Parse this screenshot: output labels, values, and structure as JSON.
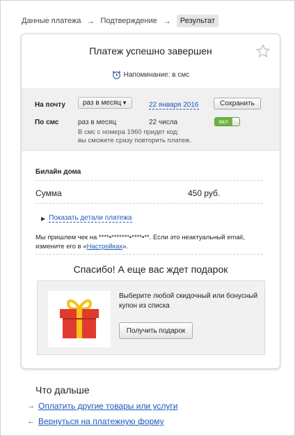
{
  "breadcrumb": {
    "steps": [
      "Данные платежа",
      "Подтверждение",
      "Результат"
    ],
    "separator": "→"
  },
  "result": {
    "title": "Платеж успешно завершен",
    "reminder": "Напоминание: в смс",
    "star_icon": "star-icon",
    "alarm_icon": "alarm-clock-icon"
  },
  "reminders": {
    "email": {
      "label": "На почту",
      "frequency": "раз в месяц",
      "date": "22 января 2016",
      "save_label": "Сохранить"
    },
    "sms": {
      "label": "По смс",
      "frequency": "раз в месяц",
      "day": "22 числа",
      "toggle_label": "вкл",
      "toggle_on": true,
      "hint_line1": "В смс с номера 1960 придет код:",
      "hint_line2": "вы сможете сразу повторить платеж."
    }
  },
  "payment": {
    "service": "Билайн дома",
    "sum_label": "Сумма",
    "sum_value": "450 руб.",
    "details_link": "Показать детали платежа"
  },
  "receipt": {
    "text_before": "Мы пришлем чек на ****•*******•****•**. Если это неактуальный email, измените его в «",
    "link": "Настройках",
    "text_after": "»."
  },
  "gift": {
    "title": "Спасибо! А еще вас ждет подарок",
    "description": "Выберите любой скидочный или бонусный купон из списка",
    "button": "Получить подарок",
    "icon": "gift-icon"
  },
  "next": {
    "title": "Что дальше",
    "links": [
      {
        "arrow": "→",
        "label": "Оплатить другие товары или услуги"
      },
      {
        "arrow": "←",
        "label": "Вернуться на платежную форму"
      }
    ]
  },
  "colors": {
    "link": "#1b58b8",
    "toggle_green": "#6cb33f",
    "gift_red": "#e03b2f",
    "gift_ribbon": "#f5c11a"
  }
}
